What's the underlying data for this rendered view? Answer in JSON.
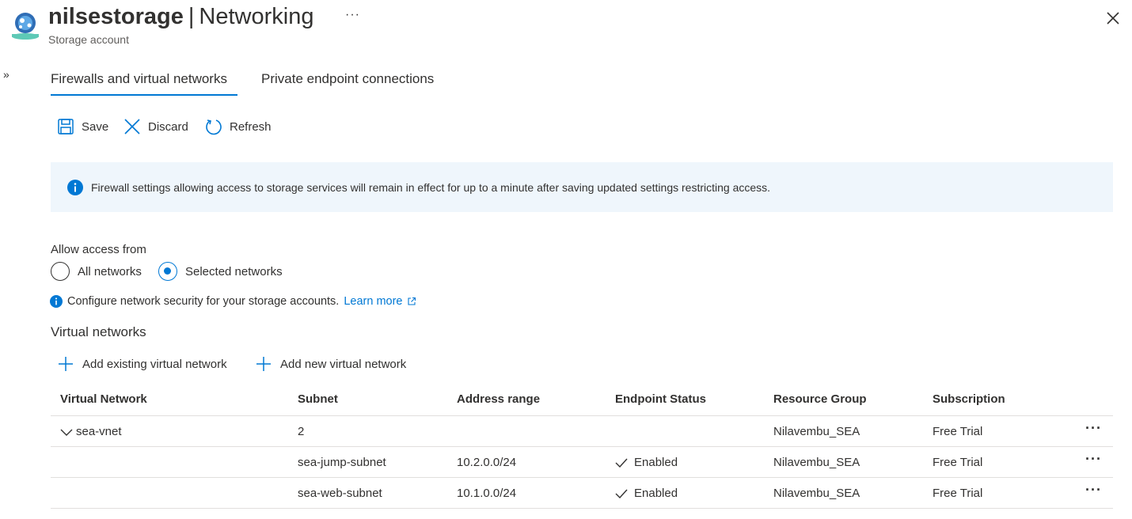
{
  "header": {
    "resource_name": "nilsestorage",
    "separator": "|",
    "blade_name": "Networking",
    "subtitle": "Storage account",
    "more_label": "···"
  },
  "nav": {
    "expand_label": "»"
  },
  "tabs": [
    {
      "label": "Firewalls and virtual networks",
      "active": true
    },
    {
      "label": "Private endpoint connections",
      "active": false
    }
  ],
  "toolbar": {
    "save_label": "Save",
    "discard_label": "Discard",
    "refresh_label": "Refresh"
  },
  "info_banner": {
    "text": "Firewall settings allowing access to storage services will remain in effect for up to a minute after saving updated settings restricting access."
  },
  "access": {
    "label": "Allow access from",
    "options": [
      {
        "label": "All networks",
        "selected": false
      },
      {
        "label": "Selected networks",
        "selected": true
      }
    ]
  },
  "config": {
    "text": "Configure network security for your storage accounts.",
    "link_label": "Learn more"
  },
  "vnets": {
    "heading": "Virtual networks",
    "add_existing_label": "Add existing virtual network",
    "add_new_label": "Add new virtual network",
    "columns": [
      "Virtual Network",
      "Subnet",
      "Address range",
      "Endpoint Status",
      "Resource Group",
      "Subscription"
    ],
    "rows": [
      {
        "vnet": "sea-vnet",
        "subnet": "2",
        "range": "",
        "status": "",
        "rg": "Nilavembu_SEA",
        "sub": "Free Trial"
      },
      {
        "vnet": "",
        "subnet": "sea-jump-subnet",
        "range": "10.2.0.0/24",
        "status": "Enabled",
        "rg": "Nilavembu_SEA",
        "sub": "Free Trial"
      },
      {
        "vnet": "",
        "subnet": "sea-web-subnet",
        "range": "10.1.0.0/24",
        "status": "Enabled",
        "rg": "Nilavembu_SEA",
        "sub": "Free Trial"
      }
    ],
    "row_more_label": "···"
  },
  "colors": {
    "accent": "#0078d4",
    "banner_bg": "#eff6fc",
    "text": "#323130",
    "divider": "#e1dfdd"
  }
}
